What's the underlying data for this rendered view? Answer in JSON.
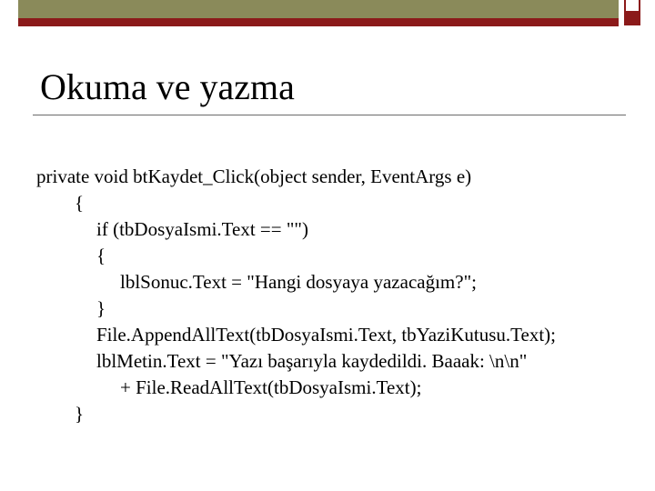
{
  "slide": {
    "title": "Okuma ve yazma",
    "accent_color": "#8b1a1a",
    "bar_color": "#8a8a5a",
    "code_lines": [
      "private void btKaydet_Click(object sender, EventArgs e)",
      "{",
      "if (tbDosyaIsmi.Text == \"\")",
      "{",
      "lblSonuc.Text = \"Hangi dosyaya yazacağım?\";",
      "}",
      "File.AppendAllText(tbDosyaIsmi.Text, tbYaziKutusu.Text);",
      "lblMetin.Text = \"Yazı başarıyla kaydedildi. Baaak: \\n\\n\"",
      "+ File.ReadAllText(tbDosyaIsmi.Text);",
      "}"
    ]
  }
}
